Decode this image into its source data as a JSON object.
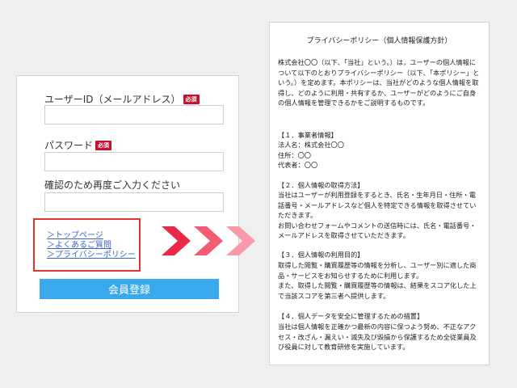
{
  "form": {
    "email_label": "ユーザーID（メールアドレス）",
    "required_badge": "必須",
    "password_label": "パスワード",
    "confirm_label": "確認のため再度ご入力ください",
    "email_value": "",
    "password_value": "",
    "confirm_value": "",
    "links": [
      "＞トップページ",
      "＞よくあるご質問",
      "＞プライバシーポリシー"
    ],
    "submit_label": "会員登録",
    "highlight_color": "#e0342f",
    "button_color": "#39a8ec"
  },
  "arrows": {
    "icon": "triple-chevron-right-icon",
    "colors": [
      "#ea2848",
      "#f25d74",
      "#f99aa8"
    ]
  },
  "policy": {
    "title": "プライバシーポリシー（個人情報保護方針）",
    "intro": "株式会社〇〇（以下、「当社」という。）は，ユーザーの個人情報について以下のとおりプライバシーポリシー（以下、「本ポリシー」という。）を定めます。本ポリシーは、当社がどのような個人情報を取得し、どのように利用・共有するか、ユーザーがどのようにご自身の個人情報を管理できるかをご説明するものです。",
    "sections": [
      {
        "heading": "【１．事業者情報】",
        "body": "法人名：株式会社〇〇\n住所：〇〇\n代表者：〇〇"
      },
      {
        "heading": "【２．個人情報の取得方法】",
        "body": "当社はユーザーが利用登録をするとき、氏名・生年月日・住所・電話番号・メールアドレスなど個人を特定できる情報を取得させていただきます。\nお問い合わせフォームやコメントの送信時には、氏名・電話番号・メールアドレスを取得させていただきます。"
      },
      {
        "heading": "【３．個人情報の利用目的】",
        "body": "取得した閲覧・購買履歴等の情報を分析し、ユーザー別に適した商品・サービスをお知らせするために利用します。\nまた、取得した閲覧・購買履歴等の情報は、結果をスコア化した上で当該スコアを第三者へ提供します。"
      },
      {
        "heading": "【４．個人データを安全に管理するための措置】",
        "body": "当社は個人情報を正確かつ最新の内容に保つよう努め、不正なアクセス・改ざん・漏えい・滅失及び毀損から保護するため全従業員及び役員に対して教育研修を実施しています。"
      }
    ]
  }
}
